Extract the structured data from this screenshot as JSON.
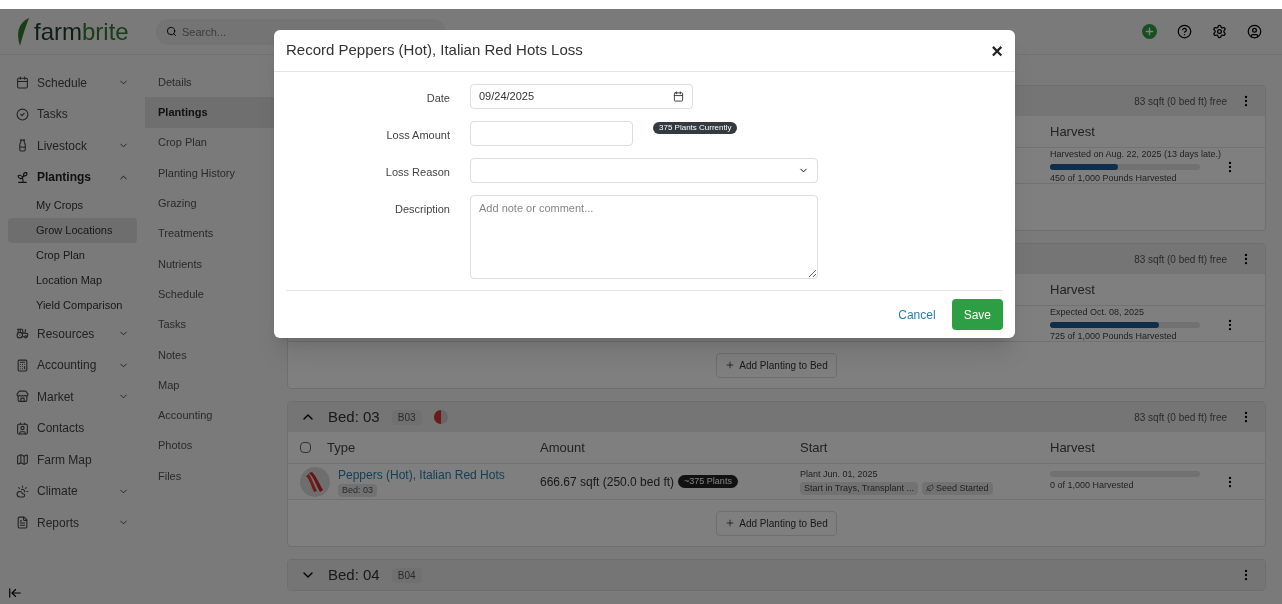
{
  "brand": {
    "part1": "farm",
    "part2": "brite"
  },
  "search": {
    "placeholder": "Search..."
  },
  "sidebar": {
    "items": [
      {
        "kind": "group",
        "label": "Schedule",
        "expanded": false
      },
      {
        "kind": "link",
        "label": "Tasks"
      },
      {
        "kind": "group",
        "label": "Livestock",
        "expanded": false
      },
      {
        "kind": "group",
        "label": "Plantings",
        "expanded": true,
        "children": [
          {
            "label": "My Crops",
            "selected": false
          },
          {
            "label": "Grow Locations",
            "selected": true
          },
          {
            "label": "Crop Plan",
            "selected": false
          },
          {
            "label": "Location Map",
            "selected": false
          },
          {
            "label": "Yield Comparison",
            "selected": false
          }
        ]
      },
      {
        "kind": "group",
        "label": "Resources",
        "expanded": false
      },
      {
        "kind": "group",
        "label": "Accounting",
        "expanded": false
      },
      {
        "kind": "group",
        "label": "Market",
        "expanded": false
      },
      {
        "kind": "link",
        "label": "Contacts"
      },
      {
        "kind": "link",
        "label": "Farm Map"
      },
      {
        "kind": "group",
        "label": "Climate",
        "expanded": false
      },
      {
        "kind": "group",
        "label": "Reports",
        "expanded": false
      }
    ]
  },
  "subnav": [
    {
      "label": "Details",
      "selected": false
    },
    {
      "label": "Plantings",
      "selected": true
    },
    {
      "label": "Crop Plan",
      "selected": false
    },
    {
      "label": "Planting History",
      "selected": false
    },
    {
      "label": "Grazing",
      "selected": false
    },
    {
      "label": "Treatments",
      "selected": false
    },
    {
      "label": "Nutrients",
      "selected": false
    },
    {
      "label": "Schedule",
      "selected": false
    },
    {
      "label": "Tasks",
      "selected": false
    },
    {
      "label": "Notes",
      "selected": false
    },
    {
      "label": "Map",
      "selected": false
    },
    {
      "label": "Accounting",
      "selected": false
    },
    {
      "label": "Photos",
      "selected": false
    },
    {
      "label": "Files",
      "selected": false
    }
  ],
  "beds": [
    {
      "free": "83 sqft (0 bed ft) free",
      "columns": [
        {
          "kind": "harvest",
          "label": "Harvest"
        }
      ],
      "rows": [
        {
          "harvest_note": "Harvested on Aug. 22, 2025 (13 days late.)",
          "level": 0.45,
          "harvest_text": "450 of 1,000 Pounds Harvested"
        }
      ]
    },
    {
      "free": "83 sqft (0 bed ft) free",
      "columns": [
        {
          "kind": "harvest",
          "label": "Harvest"
        }
      ],
      "rows": [
        {
          "harvest_note": "Expected Oct. 08, 2025",
          "level": 0.725,
          "harvest_text": "725 of 1,000 Pounds Harvested"
        }
      ],
      "add_button": "Add Planting to Bed"
    },
    {
      "title": "Bed: 03",
      "code": "B03",
      "expanded": true,
      "free": "83 sqft (0 bed ft) free",
      "checked": false,
      "columns": [
        {
          "kind": "type",
          "label": "Type"
        },
        {
          "kind": "amount",
          "label": "Amount"
        },
        {
          "kind": "start",
          "label": "Start"
        },
        {
          "kind": "harvest",
          "label": "Harvest"
        }
      ],
      "rows": [
        {
          "crop": "Peppers (Hot), Italian Red Hots",
          "bed": "Bed: 03",
          "amount": "666.67 sqft (250.0 bed ft)",
          "plants": "~375 Plants",
          "start_date": "Plant Jun. 01, 2025",
          "method": "Start in Trays, Transplant ...",
          "status": "Seed Started",
          "level": 0,
          "harvest_text": "0 of 1,000 Harvested"
        }
      ],
      "add_button": "Add Planting to Bed"
    },
    {
      "title": "Bed: 04",
      "code": "B04",
      "expanded": false
    }
  ],
  "modal": {
    "title": "Record Peppers (Hot), Italian Red Hots Loss",
    "close": "×",
    "fields": [
      {
        "kind": "date",
        "label": "Date",
        "value": "09/24/2025"
      },
      {
        "kind": "number",
        "label": "Loss Amount",
        "badge": "375 Plants Currently"
      },
      {
        "kind": "select",
        "label": "Loss Reason"
      },
      {
        "kind": "textarea",
        "label": "Description",
        "placeholder": "Add note or comment..."
      }
    ],
    "cancel": "Cancel",
    "save": "Save"
  }
}
